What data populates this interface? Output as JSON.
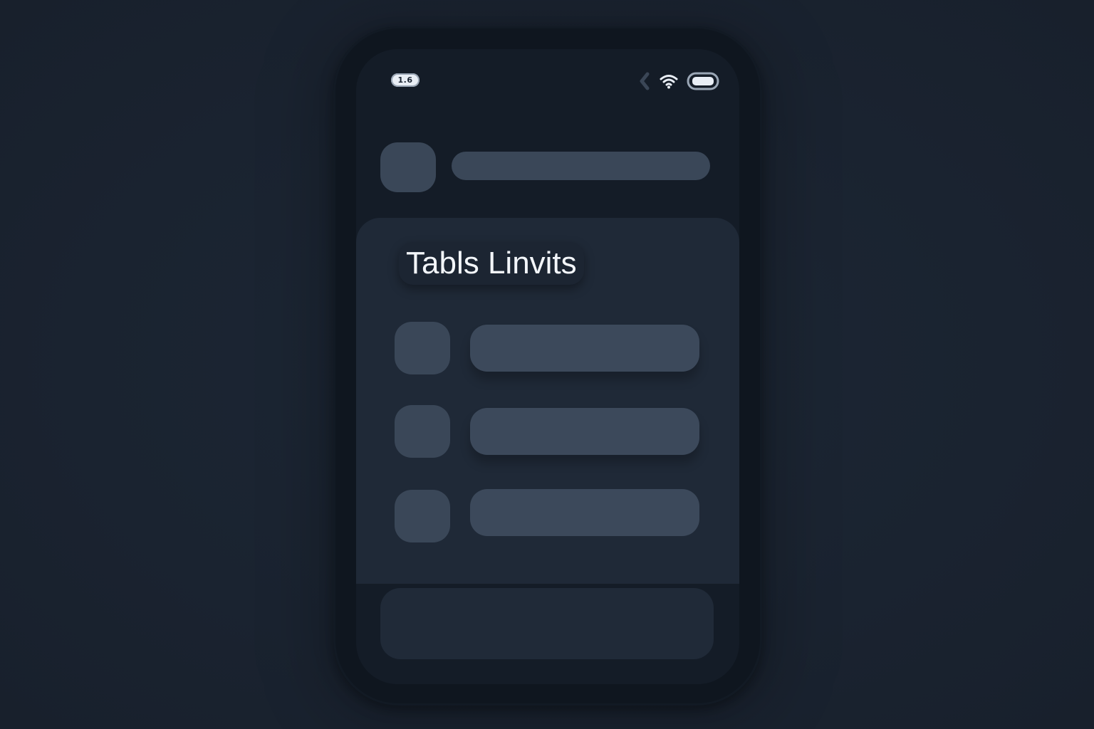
{
  "status_bar": {
    "time": "1.6",
    "icons": [
      "back-chevron-icon",
      "wifi-icon",
      "battery-icon"
    ]
  },
  "card": {
    "title": "Tabls Linvits"
  },
  "colors": {
    "background": "#1b2431",
    "device": "#0f161f",
    "screen": "#141c27",
    "card": "#1f2937",
    "placeholder": "#3a4758",
    "title_text": "#f3f6fa"
  }
}
